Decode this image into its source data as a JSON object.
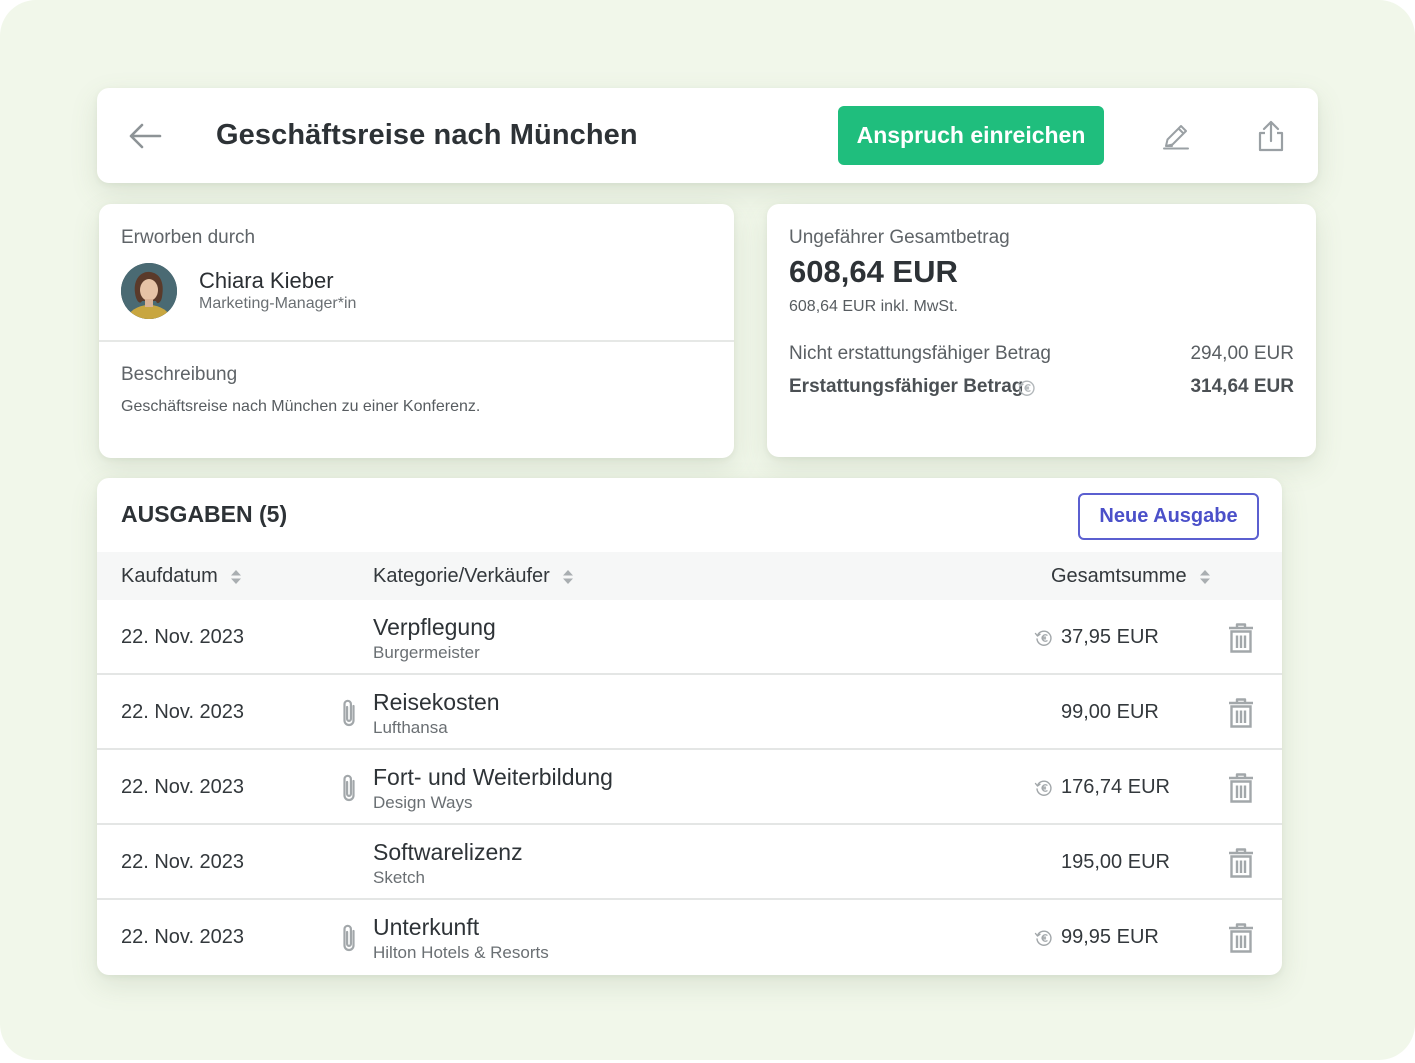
{
  "header": {
    "title": "Geschäftsreise nach München",
    "submit_label": "Anspruch einreichen"
  },
  "owner": {
    "acquired_by_label": "Erworben durch",
    "name": "Chiara Kieber",
    "role": "Marketing-Manager*in",
    "description_label": "Beschreibung",
    "description": "Geschäftsreise nach München zu einer Konferenz."
  },
  "summary": {
    "label": "Ungefährer Gesamtbetrag",
    "total": "608,64 EUR",
    "total_incl": "608,64 EUR inkl. MwSt.",
    "non_refundable_label": "Nicht erstattungsfähiger Betrag",
    "non_refundable_value": "294,00 EUR",
    "refundable_label": "Erstattungsfähiger Betrag",
    "refundable_value": "314,64 EUR"
  },
  "expenses": {
    "title": "AUSGABEN (5)",
    "new_label": "Neue Ausgabe",
    "columns": {
      "date": "Kaufdatum",
      "category": "Kategorie/Verkäufer",
      "total": "Gesamtsumme"
    },
    "rows": [
      {
        "date": "22. Nov. 2023",
        "category": "Verpflegung",
        "vendor": "Burgermeister",
        "amount": "37,95 EUR",
        "attachment": false,
        "refundable": true
      },
      {
        "date": "22. Nov. 2023",
        "category": "Reisekosten",
        "vendor": "Lufthansa",
        "amount": "99,00 EUR",
        "attachment": true,
        "refundable": false
      },
      {
        "date": "22. Nov. 2023",
        "category": "Fort- und Weiterbildung",
        "vendor": "Design Ways",
        "amount": "176,74 EUR",
        "attachment": true,
        "refundable": true
      },
      {
        "date": "22. Nov. 2023",
        "category": "Softwarelizenz",
        "vendor": "Sketch",
        "amount": "195,00 EUR",
        "attachment": false,
        "refundable": false
      },
      {
        "date": "22. Nov. 2023",
        "category": "Unterkunft",
        "vendor": "Hilton Hotels & Resorts",
        "amount": "99,95 EUR",
        "attachment": true,
        "refundable": true
      }
    ]
  },
  "colors": {
    "background": "#f1f7ea",
    "primary_green": "#1fbe7d",
    "accent_indigo": "#4b50c9",
    "text_dark": "#2d3236",
    "icon_gray": "#9aa0a4"
  },
  "icons": [
    "back-arrow-icon",
    "pencil-icon",
    "share-icon",
    "euro-refund-icon",
    "paperclip-icon",
    "trash-icon",
    "sort-icon"
  ]
}
